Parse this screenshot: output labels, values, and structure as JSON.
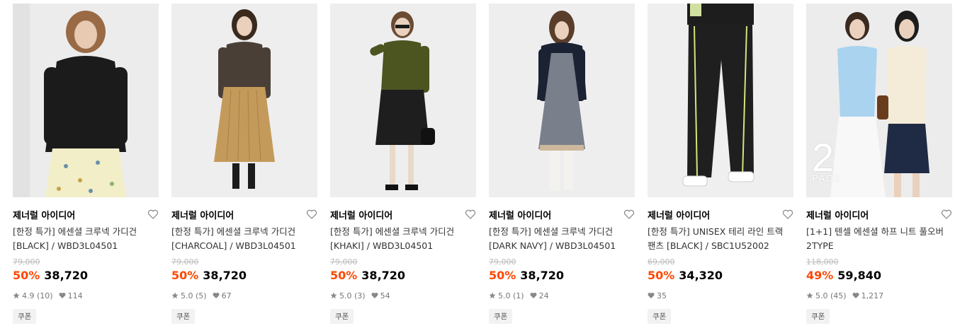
{
  "colors": {
    "discount": "#ff4800",
    "strike": "#bbbbbb",
    "background": "#ffffff"
  },
  "products": [
    {
      "brand": "제너럴 아이디어",
      "name_line1": "[한정 특가] 에센셜 크루넥 가디건",
      "name_line2": "[BLACK] / WBD3L04501",
      "original_price": "79,000",
      "discount": "50%",
      "price": "38,720",
      "rating": "4.9 (10)",
      "likes": "114",
      "coupon": "쿠폰",
      "photo_icon": "model-photo-black-cardigan"
    },
    {
      "brand": "제너럴 아이디어",
      "name_line1": "[한정 특가] 에센셜 크루넥 가디건",
      "name_line2": "[CHARCOAL] / WBD3L04501",
      "original_price": "79,000",
      "discount": "50%",
      "price": "38,720",
      "rating": "5.0 (5)",
      "likes": "67",
      "coupon": "쿠폰",
      "photo_icon": "model-photo-charcoal-cardigan"
    },
    {
      "brand": "제너럴 아이디어",
      "name_line1": "[한정 특가] 에센셜 크루넥 가디건",
      "name_line2": "[KHAKI] / WBD3L04501",
      "original_price": "79,000",
      "discount": "50%",
      "price": "38,720",
      "rating": "5.0 (3)",
      "likes": "54",
      "coupon": "쿠폰",
      "photo_icon": "model-photo-khaki-cardigan"
    },
    {
      "brand": "제너럴 아이디어",
      "name_line1": "[한정 특가] 에센셜 크루넥 가디건",
      "name_line2": "[DARK NAVY] / WBD3L04501",
      "original_price": "79,000",
      "discount": "50%",
      "price": "38,720",
      "rating": "5.0 (1)",
      "likes": "24",
      "coupon": "쿠폰",
      "photo_icon": "model-photo-navy-cardigan"
    },
    {
      "brand": "제너럴 아이디어",
      "name_line1": "[한정 특가] UNISEX 테리 라인 트랙",
      "name_line2": "팬츠 [BLACK] / SBC1U52002",
      "original_price": "69,000",
      "discount": "50%",
      "price": "34,320",
      "rating": "",
      "likes": "35",
      "coupon": "쿠폰",
      "photo_icon": "model-photo-track-pants"
    },
    {
      "brand": "제너럴 아이디어",
      "name_line1": "[1+1] 텐셀 에센셜 하프 니트 풀오버",
      "name_line2": "2TYPE",
      "original_price": "118,000",
      "discount": "49%",
      "price": "59,840",
      "rating": "5.0 (45)",
      "likes": "1,217",
      "coupon": "쿠폰",
      "photo_icon": "model-photo-knit-pullover",
      "pack_number": "2",
      "pack_word": "PACK"
    }
  ]
}
